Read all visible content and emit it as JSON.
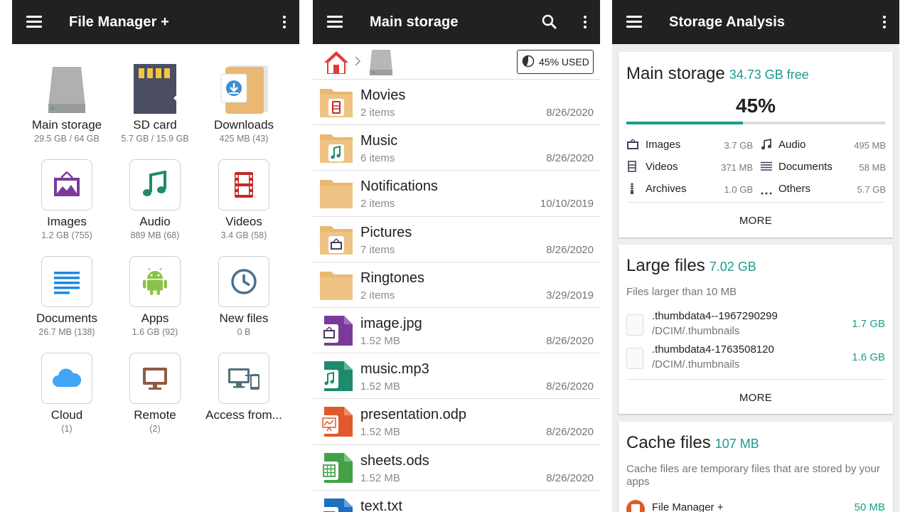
{
  "panel1": {
    "title": "File Manager +",
    "items": [
      {
        "label": "Main storage",
        "sub": "29.5 GB / 64 GB"
      },
      {
        "label": "SD card",
        "sub": "5.7 GB / 15.9 GB"
      },
      {
        "label": "Downloads",
        "sub": "425 MB (43)"
      },
      {
        "label": "Images",
        "sub": "1.2 GB (755)"
      },
      {
        "label": "Audio",
        "sub": "889 MB (68)"
      },
      {
        "label": "Videos",
        "sub": "3.4 GB (58)"
      },
      {
        "label": "Documents",
        "sub": "26.7 MB (138)"
      },
      {
        "label": "Apps",
        "sub": "1.6 GB (92)"
      },
      {
        "label": "New files",
        "sub": "0 B"
      },
      {
        "label": "Cloud",
        "sub": "(1)"
      },
      {
        "label": "Remote",
        "sub": "(2)"
      },
      {
        "label": "Access from...",
        "sub": ""
      }
    ]
  },
  "panel2": {
    "title": "Main storage",
    "used_label": "45% USED",
    "used_fraction": 0.45,
    "rows": [
      {
        "name": "Movies",
        "sub": "2 items",
        "date": "8/26/2020",
        "icon": "folder-video-icon"
      },
      {
        "name": "Music",
        "sub": "6 items",
        "date": "8/26/2020",
        "icon": "folder-music-icon"
      },
      {
        "name": "Notifications",
        "sub": "2 items",
        "date": "10/10/2019",
        "icon": "folder-icon"
      },
      {
        "name": "Pictures",
        "sub": "7 items",
        "date": "8/26/2020",
        "icon": "folder-image-icon"
      },
      {
        "name": "Ringtones",
        "sub": "2 items",
        "date": "3/29/2019",
        "icon": "folder-icon"
      },
      {
        "name": "image.jpg",
        "sub": "1.52 MB",
        "date": "8/26/2020",
        "icon": "image-file-icon"
      },
      {
        "name": "music.mp3",
        "sub": "1.52 MB",
        "date": "8/26/2020",
        "icon": "audio-file-icon"
      },
      {
        "name": "presentation.odp",
        "sub": "1.52 MB",
        "date": "8/26/2020",
        "icon": "presentation-file-icon"
      },
      {
        "name": "sheets.ods",
        "sub": "1.52 MB",
        "date": "8/26/2020",
        "icon": "spreadsheet-file-icon"
      },
      {
        "name": "text.txt",
        "sub": "",
        "date": "",
        "icon": "text-file-icon"
      }
    ]
  },
  "panel3": {
    "title": "Storage Analysis",
    "main": {
      "heading": "Main storage",
      "free": "34.73 GB free",
      "percent": "45%",
      "used_fraction": 0.45,
      "categories": [
        {
          "label": "Images",
          "size": "3.7 GB"
        },
        {
          "label": "Audio",
          "size": "495 MB"
        },
        {
          "label": "Videos",
          "size": "371 MB"
        },
        {
          "label": "Documents",
          "size": "58 MB"
        },
        {
          "label": "Archives",
          "size": "1.0 GB"
        },
        {
          "label": "Others",
          "size": "5.7 GB"
        }
      ],
      "more": "MORE"
    },
    "large": {
      "heading": "Large files",
      "total": "7.02 GB",
      "desc": "Files larger than 10 MB",
      "files": [
        {
          "name": ".thumbdata4--1967290299",
          "path": "/DCIM/.thumbnails",
          "size": "1.7 GB"
        },
        {
          "name": ".thumbdata4-1763508120",
          "path": "/DCIM/.thumbnails",
          "size": "1.6 GB"
        }
      ],
      "more": "MORE"
    },
    "cache": {
      "heading": "Cache files",
      "total": "107 MB",
      "desc": "Cache files are temporary files that are stored by your apps",
      "app": {
        "name": "File Manager +",
        "size": "50 MB"
      }
    }
  },
  "colors": {
    "accent": "#1a9c8c",
    "appbar": "#212121",
    "folder": "#e9b872"
  }
}
